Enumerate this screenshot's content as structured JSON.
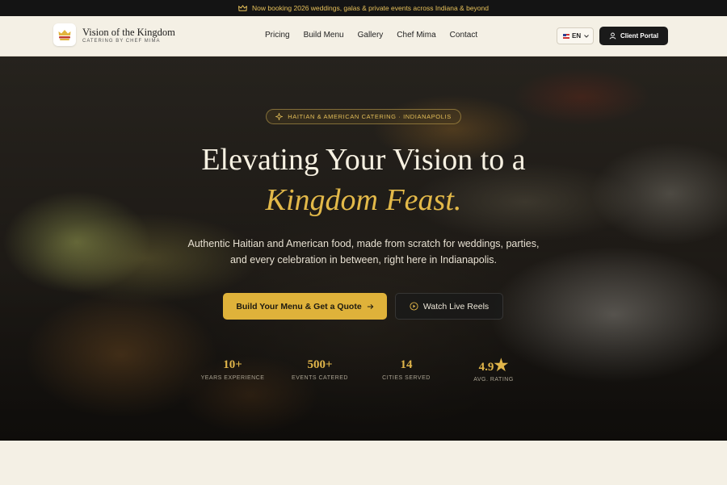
{
  "announcement": {
    "icon": "crown-icon",
    "text": "Now booking 2026 weddings, galas & private events across Indiana & beyond"
  },
  "header": {
    "brand_name": "Vision of the Kingdom",
    "brand_sub": "CATERING BY CHEF MIMA",
    "nav": [
      "Pricing",
      "Build Menu",
      "Gallery",
      "Chef Mima",
      "Contact"
    ],
    "language": "EN",
    "portal_label": "Client Portal"
  },
  "hero": {
    "badge": "HAITIAN & AMERICAN CATERING · INDIANAPOLIS",
    "title_line1": "Elevating Your Vision to a",
    "title_line2": "Kingdom Feast.",
    "lead": "Authentic Haitian and American food, made from scratch for weddings, parties, and every celebration in between, right here in Indianapolis.",
    "primary_cta": "Build Your Menu & Get a Quote",
    "secondary_cta": "Watch Live Reels",
    "stats": [
      {
        "value": "10+",
        "label": "YEARS EXPERIENCE"
      },
      {
        "value": "500+",
        "label": "EVENTS CATERED"
      },
      {
        "value": "14",
        "label": "CITIES SERVED"
      },
      {
        "value": "4.9",
        "label": "AVG. RATING"
      }
    ]
  },
  "colors": {
    "accent_gold": "#dfb23a",
    "dark": "#141414",
    "cream": "#f4f0e5"
  }
}
